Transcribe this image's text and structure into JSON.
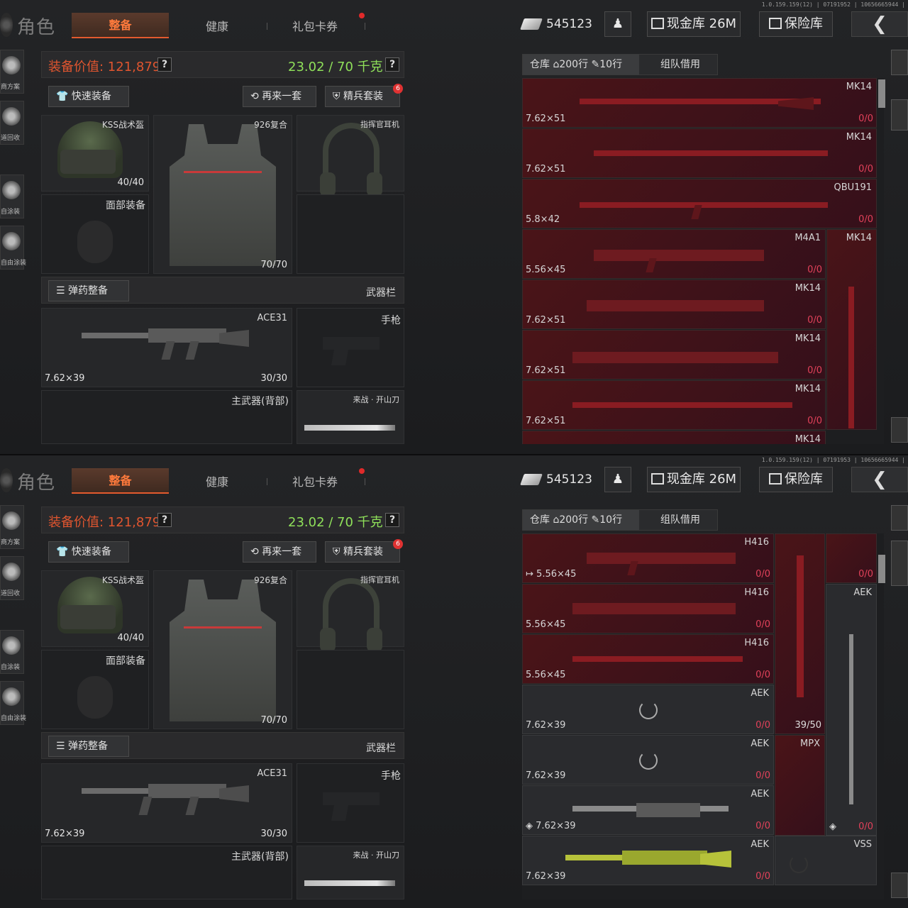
{
  "header": {
    "title": "角色",
    "tabs": [
      "整备",
      "健康",
      "礼包卡券"
    ],
    "money": "545123",
    "cash_vault": "现金库 26M",
    "safe_vault": "保险库",
    "back_icon": "chevron-left-icon"
  },
  "sidebar": {
    "items": [
      "商方案",
      "道回收",
      "自涂装",
      "自由涂装"
    ]
  },
  "loadout": {
    "value_label": "装备价值: 121,879",
    "weight_label": "23.02 / 70 千克",
    "help": "?",
    "quick_equip": "快速装备",
    "again": "再来一套",
    "elite_set": "精兵套装",
    "elite_badge": "6",
    "helmet_name": "KSS战术盔",
    "helmet_dur": "40/40",
    "face_label": "面部装备",
    "vest_name": "926复合",
    "vest_dur": "70/70",
    "headset_name": "指挥官耳机",
    "ammo_label": "弹药整备",
    "weapon_bar": "武器栏",
    "primary_name": "ACE31",
    "primary_caliber": "7.62×39",
    "primary_ammo": "30/30",
    "pistol_label": "手枪",
    "back_primary_label": "主武器(背部)",
    "melee_label": "来战 · 开山刀"
  },
  "panels": [
    {
      "version": "1.0.159.159(12) | 07191952 | 10656665944 |",
      "storage_tabs": {
        "warehouse": "仓库",
        "rows": "200行",
        "ticket_rows": "10行",
        "team_borrow": "组队借用"
      },
      "cells": [
        {
          "name": "MK14",
          "caliber": "7.62×51",
          "count": "0/0"
        },
        {
          "name": "MK14",
          "caliber": "7.62×51",
          "count": "0/0"
        },
        {
          "name": "QBU191",
          "caliber": "5.8×42",
          "count": "0/0"
        },
        {
          "name": "M4A1",
          "caliber": "5.56×45",
          "count": "0/0"
        },
        {
          "name": "MK14",
          "caliber": "7.62×51",
          "count": "0/0"
        },
        {
          "name": "MK14",
          "caliber": "7.62×51",
          "count": "0/0"
        },
        {
          "name": "MK14",
          "caliber": "7.62×51",
          "count": "0/0"
        }
      ],
      "side_cell": "MK14",
      "bottom_cell": "MK14"
    },
    {
      "version": "1.0.159.159(12) | 07191953 | 10656665944 |",
      "storage_tabs": {
        "warehouse": "仓库",
        "rows": "200行",
        "ticket_rows": "10行",
        "team_borrow": "组队借用"
      },
      "cells": [
        {
          "name": "H416",
          "caliber": "5.56×45",
          "count": "0/0"
        },
        {
          "name": "H416",
          "caliber": "5.56×45",
          "count": "0/0"
        },
        {
          "name": "H416",
          "caliber": "5.56×45",
          "count": "0/0"
        },
        {
          "name": "AEK",
          "caliber": "7.62×39",
          "count": "0/0"
        },
        {
          "name": "AEK",
          "caliber": "7.62×39",
          "count": "0/0"
        },
        {
          "name": "AEK",
          "caliber": "7.62×39",
          "count": "0/0"
        },
        {
          "name": "AEK",
          "caliber": "7.62×39",
          "count": "0/0"
        }
      ],
      "side_top_count": "0/0",
      "side_aek": "AEK",
      "side_mid_count": "39/50",
      "side_mpx": "MPX",
      "side_low_count": "0/0",
      "side_vss": "VSS"
    }
  ],
  "colors": {
    "accent": "#ff7a3c",
    "value_red": "#e0552f",
    "weight_green": "#8fe05a",
    "count_red": "#e2415a"
  }
}
